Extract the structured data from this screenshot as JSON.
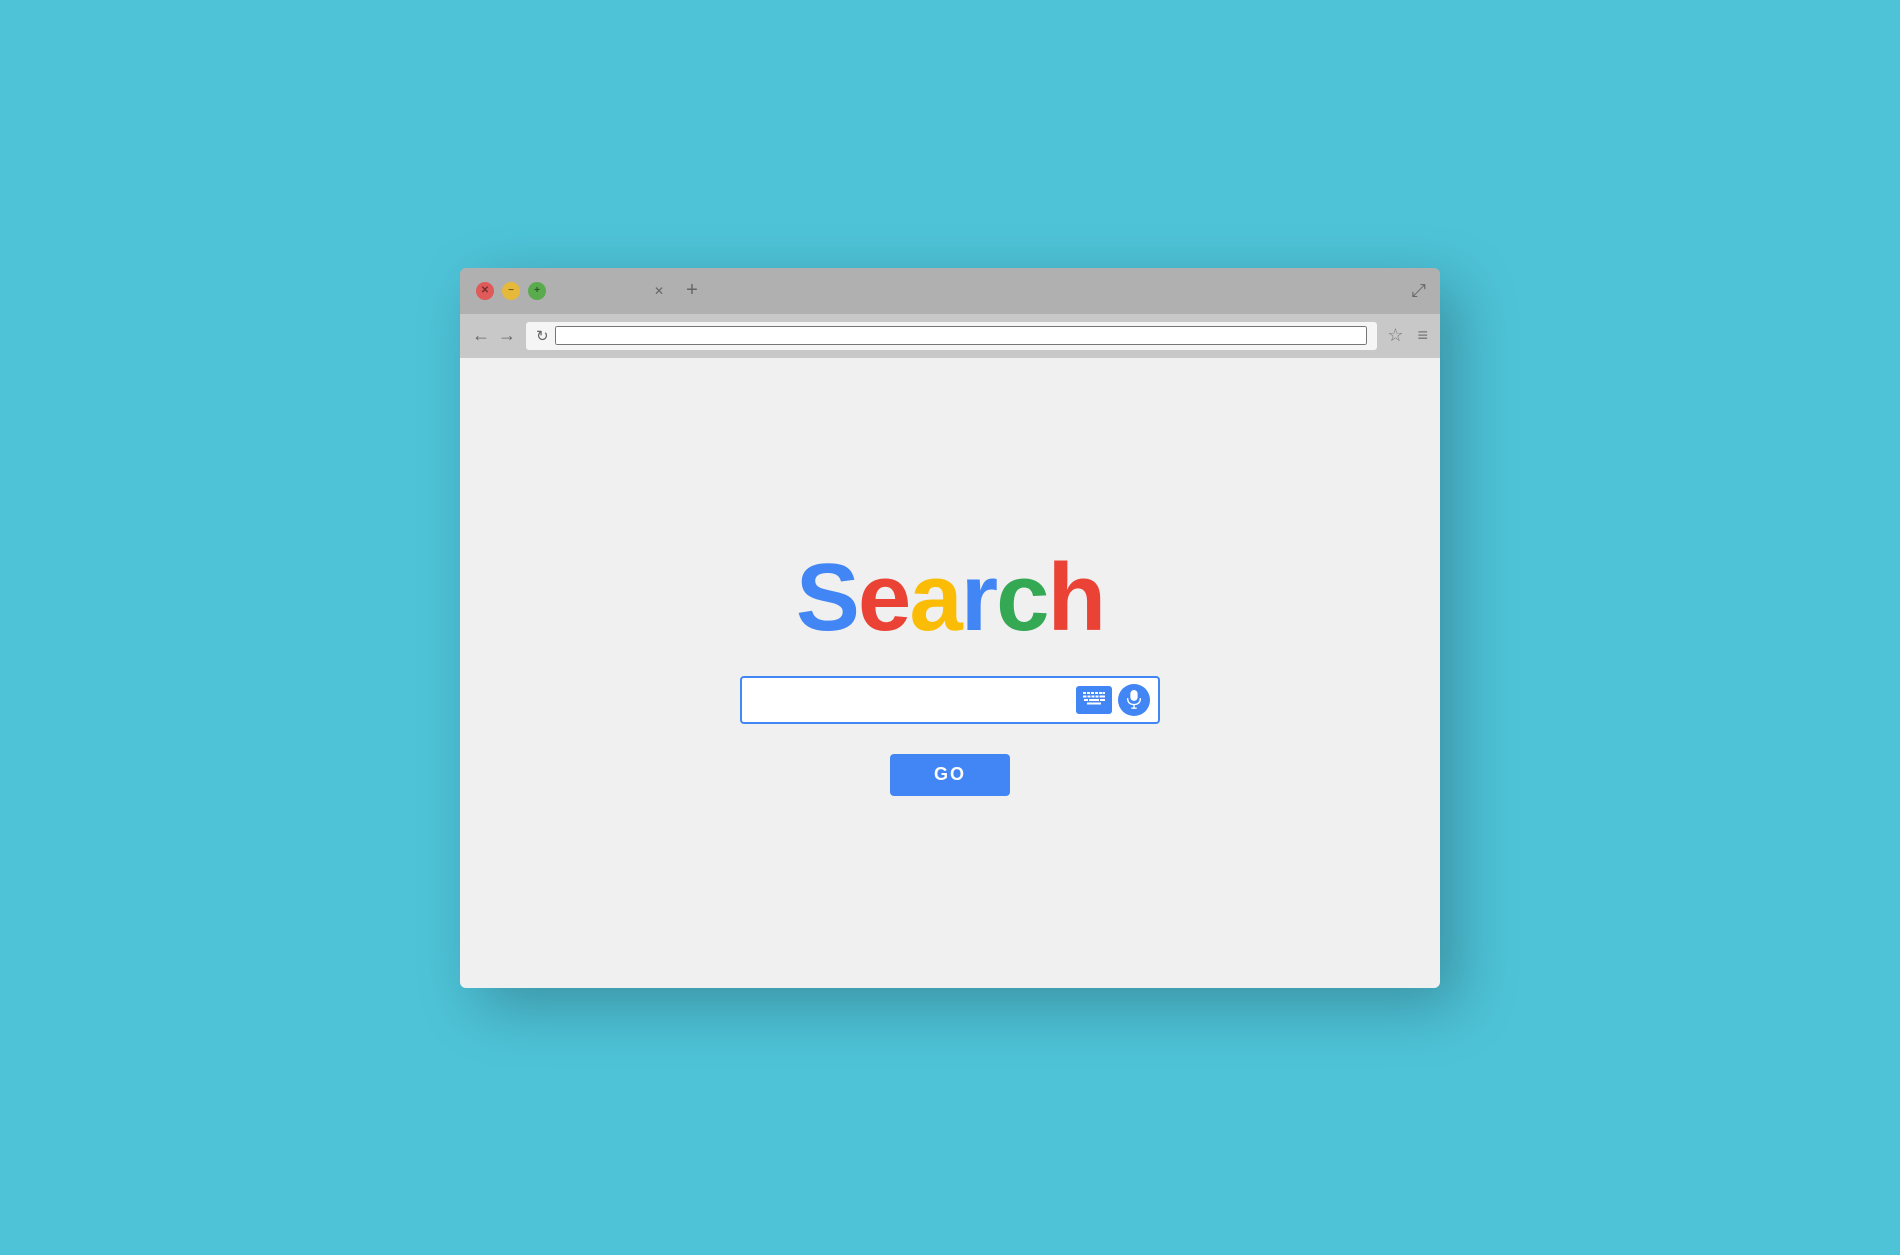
{
  "background": {
    "color": "#4ec3d8"
  },
  "browser": {
    "traffic_lights": {
      "close_label": "×",
      "minimize_label": "−",
      "maximize_label": "+"
    },
    "tab": {
      "close_symbol": "×",
      "add_symbol": "+"
    },
    "expand_symbol": "⤢",
    "nav": {
      "back_symbol": "←",
      "forward_symbol": "→",
      "reload_symbol": "↻"
    },
    "address_bar": {
      "value": "",
      "placeholder": ""
    },
    "star_symbol": "☆",
    "menu_symbol": "≡"
  },
  "page": {
    "logo": {
      "letters": [
        {
          "char": "S",
          "color": "#4285f4"
        },
        {
          "char": "e",
          "color": "#ea4335"
        },
        {
          "char": "a",
          "color": "#fbbc05"
        },
        {
          "char": "r",
          "color": "#4285f4"
        },
        {
          "char": "c",
          "color": "#34a853"
        },
        {
          "char": "h",
          "color": "#ea4335"
        }
      ]
    },
    "search_input_placeholder": "",
    "go_button_label": "GO"
  }
}
